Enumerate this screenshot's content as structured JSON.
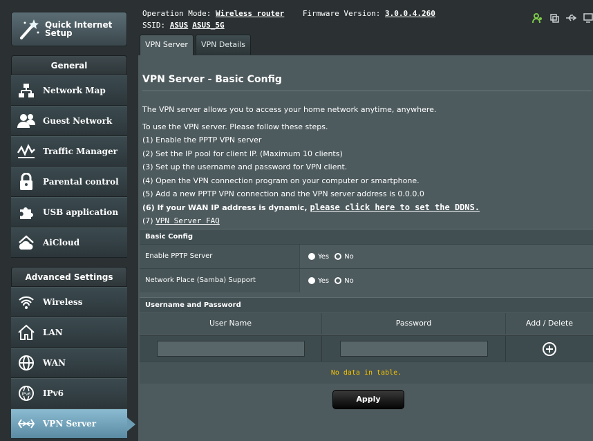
{
  "sidebar": {
    "qis_label_line1": "Quick Internet",
    "qis_label_line2": "Setup",
    "general_header": "General",
    "general_items": [
      {
        "label": "Network Map",
        "icon": "network-map-icon"
      },
      {
        "label": "Guest Network",
        "icon": "guest-network-icon"
      },
      {
        "label": "Traffic Manager",
        "icon": "traffic-manager-icon"
      },
      {
        "label": "Parental control",
        "icon": "lock-icon"
      },
      {
        "label": "USB application",
        "icon": "puzzle-icon"
      },
      {
        "label": "AiCloud",
        "icon": "cloud-home-icon"
      }
    ],
    "advanced_header": "Advanced Settings",
    "advanced_items": [
      {
        "label": "Wireless",
        "icon": "wifi-icon"
      },
      {
        "label": "LAN",
        "icon": "home-icon"
      },
      {
        "label": "WAN",
        "icon": "globe-icon"
      },
      {
        "label": "IPv6",
        "icon": "ipv6-globe-icon"
      },
      {
        "label": "VPN Server",
        "icon": "vpn-icon",
        "active": true
      }
    ]
  },
  "topbar": {
    "op_mode_label": "Operation Mode:",
    "op_mode_value": "Wireless router",
    "firmware_label": "Firmware Version:",
    "firmware_value": "3.0.0.4.260",
    "ssid_label": "SSID:",
    "ssid_values": [
      "ASUS",
      "ASUS_5G"
    ],
    "tabs": [
      "VPN Server",
      "VPN Details"
    ]
  },
  "main": {
    "title": "VPN Server - Basic Config",
    "intro": "The VPN server allows you to access your home network anytime, anywhere.",
    "steps_intro": "To use the VPN server. Please follow these steps.",
    "steps": [
      "(1) Enable the PPTP VPN server",
      "(2) Set the IP pool for client IP. (Maximum 10 clients)",
      "(3) Set up the username and password for VPN client.",
      "(4) Open the VPN connection program on your computer or smartphone.",
      "(5) Add a new PPTP VPN connection and the VPN server address is 0.0.0.0"
    ],
    "step6_text": "(6) If your WAN IP address is dynamic,",
    "step6_link": "please click here to set the DDNS.",
    "step7_prefix": "(7)",
    "step7_link": "VPN Server FAQ",
    "basic_config_header": "Basic Config",
    "rows": [
      {
        "label": "Enable PPTP Server",
        "yes": "Yes",
        "no": "No"
      },
      {
        "label": "Network Place (Samba) Support",
        "yes": "Yes",
        "no": "No"
      }
    ],
    "user_pass_header": "Username and Password",
    "columns": [
      "User Name",
      "Password",
      "Add / Delete"
    ],
    "no_data": "No data in table.",
    "apply": "Apply"
  },
  "colors": {
    "accent_green": "#7ec84a",
    "nodata_yellow": "#f2c200"
  }
}
